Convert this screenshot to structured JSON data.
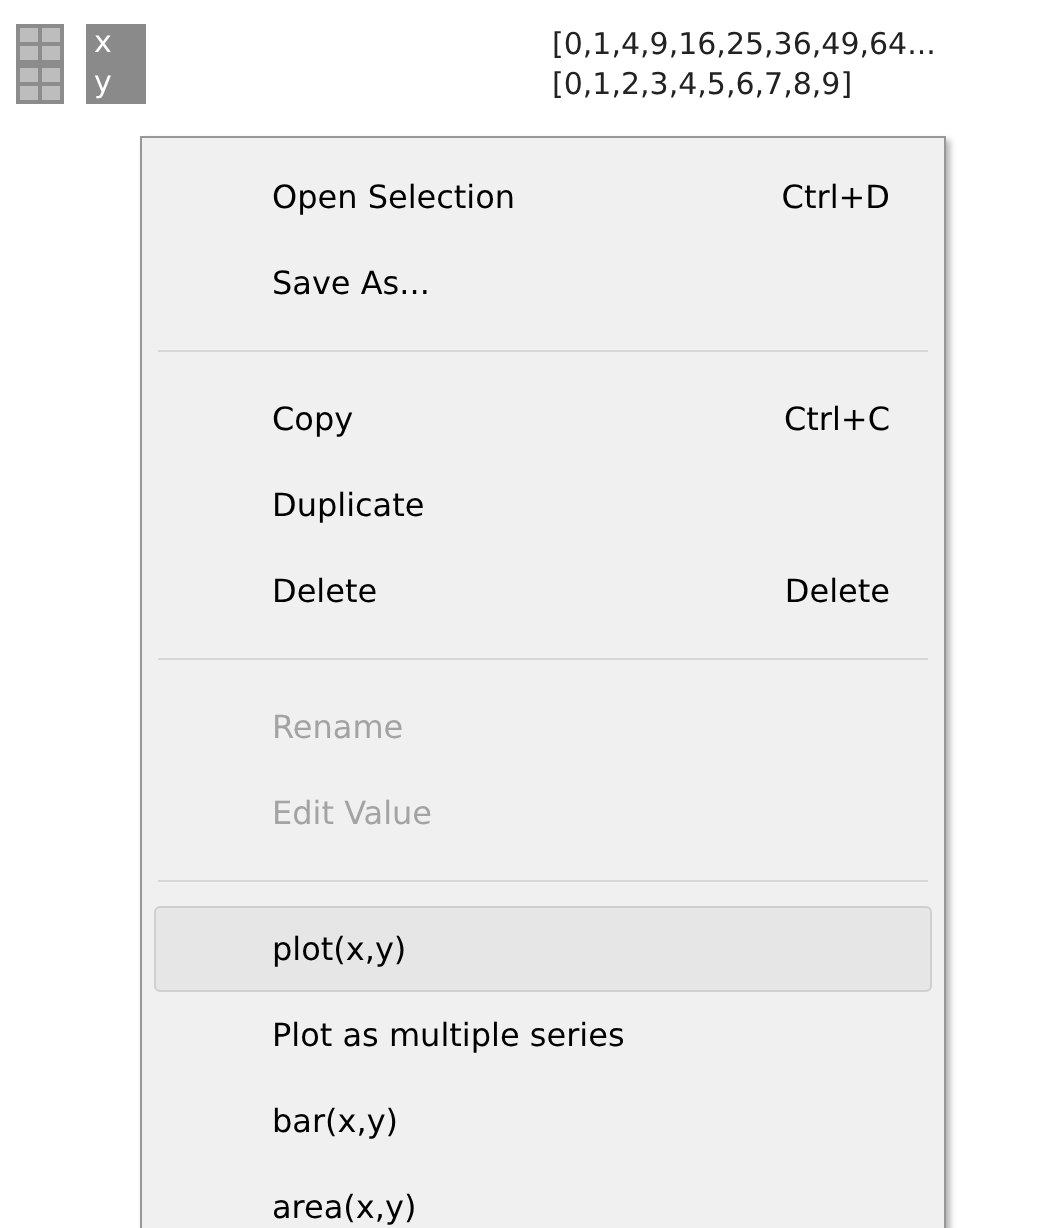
{
  "variables": [
    {
      "name": "x",
      "value": "[0,1,4,9,16,25,36,49,64...",
      "selected": true
    },
    {
      "name": "y",
      "value": "[0,1,2,3,4,5,6,7,8,9]",
      "selected": true
    }
  ],
  "context_menu": [
    {
      "kind": "item",
      "label": "Open Selection",
      "shortcut": "Ctrl+D",
      "disabled": false,
      "highlighted": false
    },
    {
      "kind": "item",
      "label": "Save As...",
      "disabled": false,
      "highlighted": false
    },
    {
      "kind": "separator"
    },
    {
      "kind": "item",
      "label": "Copy",
      "shortcut": "Ctrl+C",
      "disabled": false,
      "highlighted": false
    },
    {
      "kind": "item",
      "label": "Duplicate",
      "disabled": false,
      "highlighted": false
    },
    {
      "kind": "item",
      "label": "Delete",
      "shortcut": "Delete",
      "disabled": false,
      "highlighted": false
    },
    {
      "kind": "separator"
    },
    {
      "kind": "item",
      "label": "Rename",
      "disabled": true,
      "highlighted": false
    },
    {
      "kind": "item",
      "label": "Edit Value",
      "disabled": true,
      "highlighted": false
    },
    {
      "kind": "separator"
    },
    {
      "kind": "item",
      "label": "plot(x,y)",
      "disabled": false,
      "highlighted": true
    },
    {
      "kind": "item",
      "label": "Plot as multiple series",
      "disabled": false,
      "highlighted": false
    },
    {
      "kind": "item",
      "label": "bar(x,y)",
      "disabled": false,
      "highlighted": false
    },
    {
      "kind": "item",
      "label": "area(x,y)",
      "disabled": false,
      "highlighted": false
    }
  ]
}
